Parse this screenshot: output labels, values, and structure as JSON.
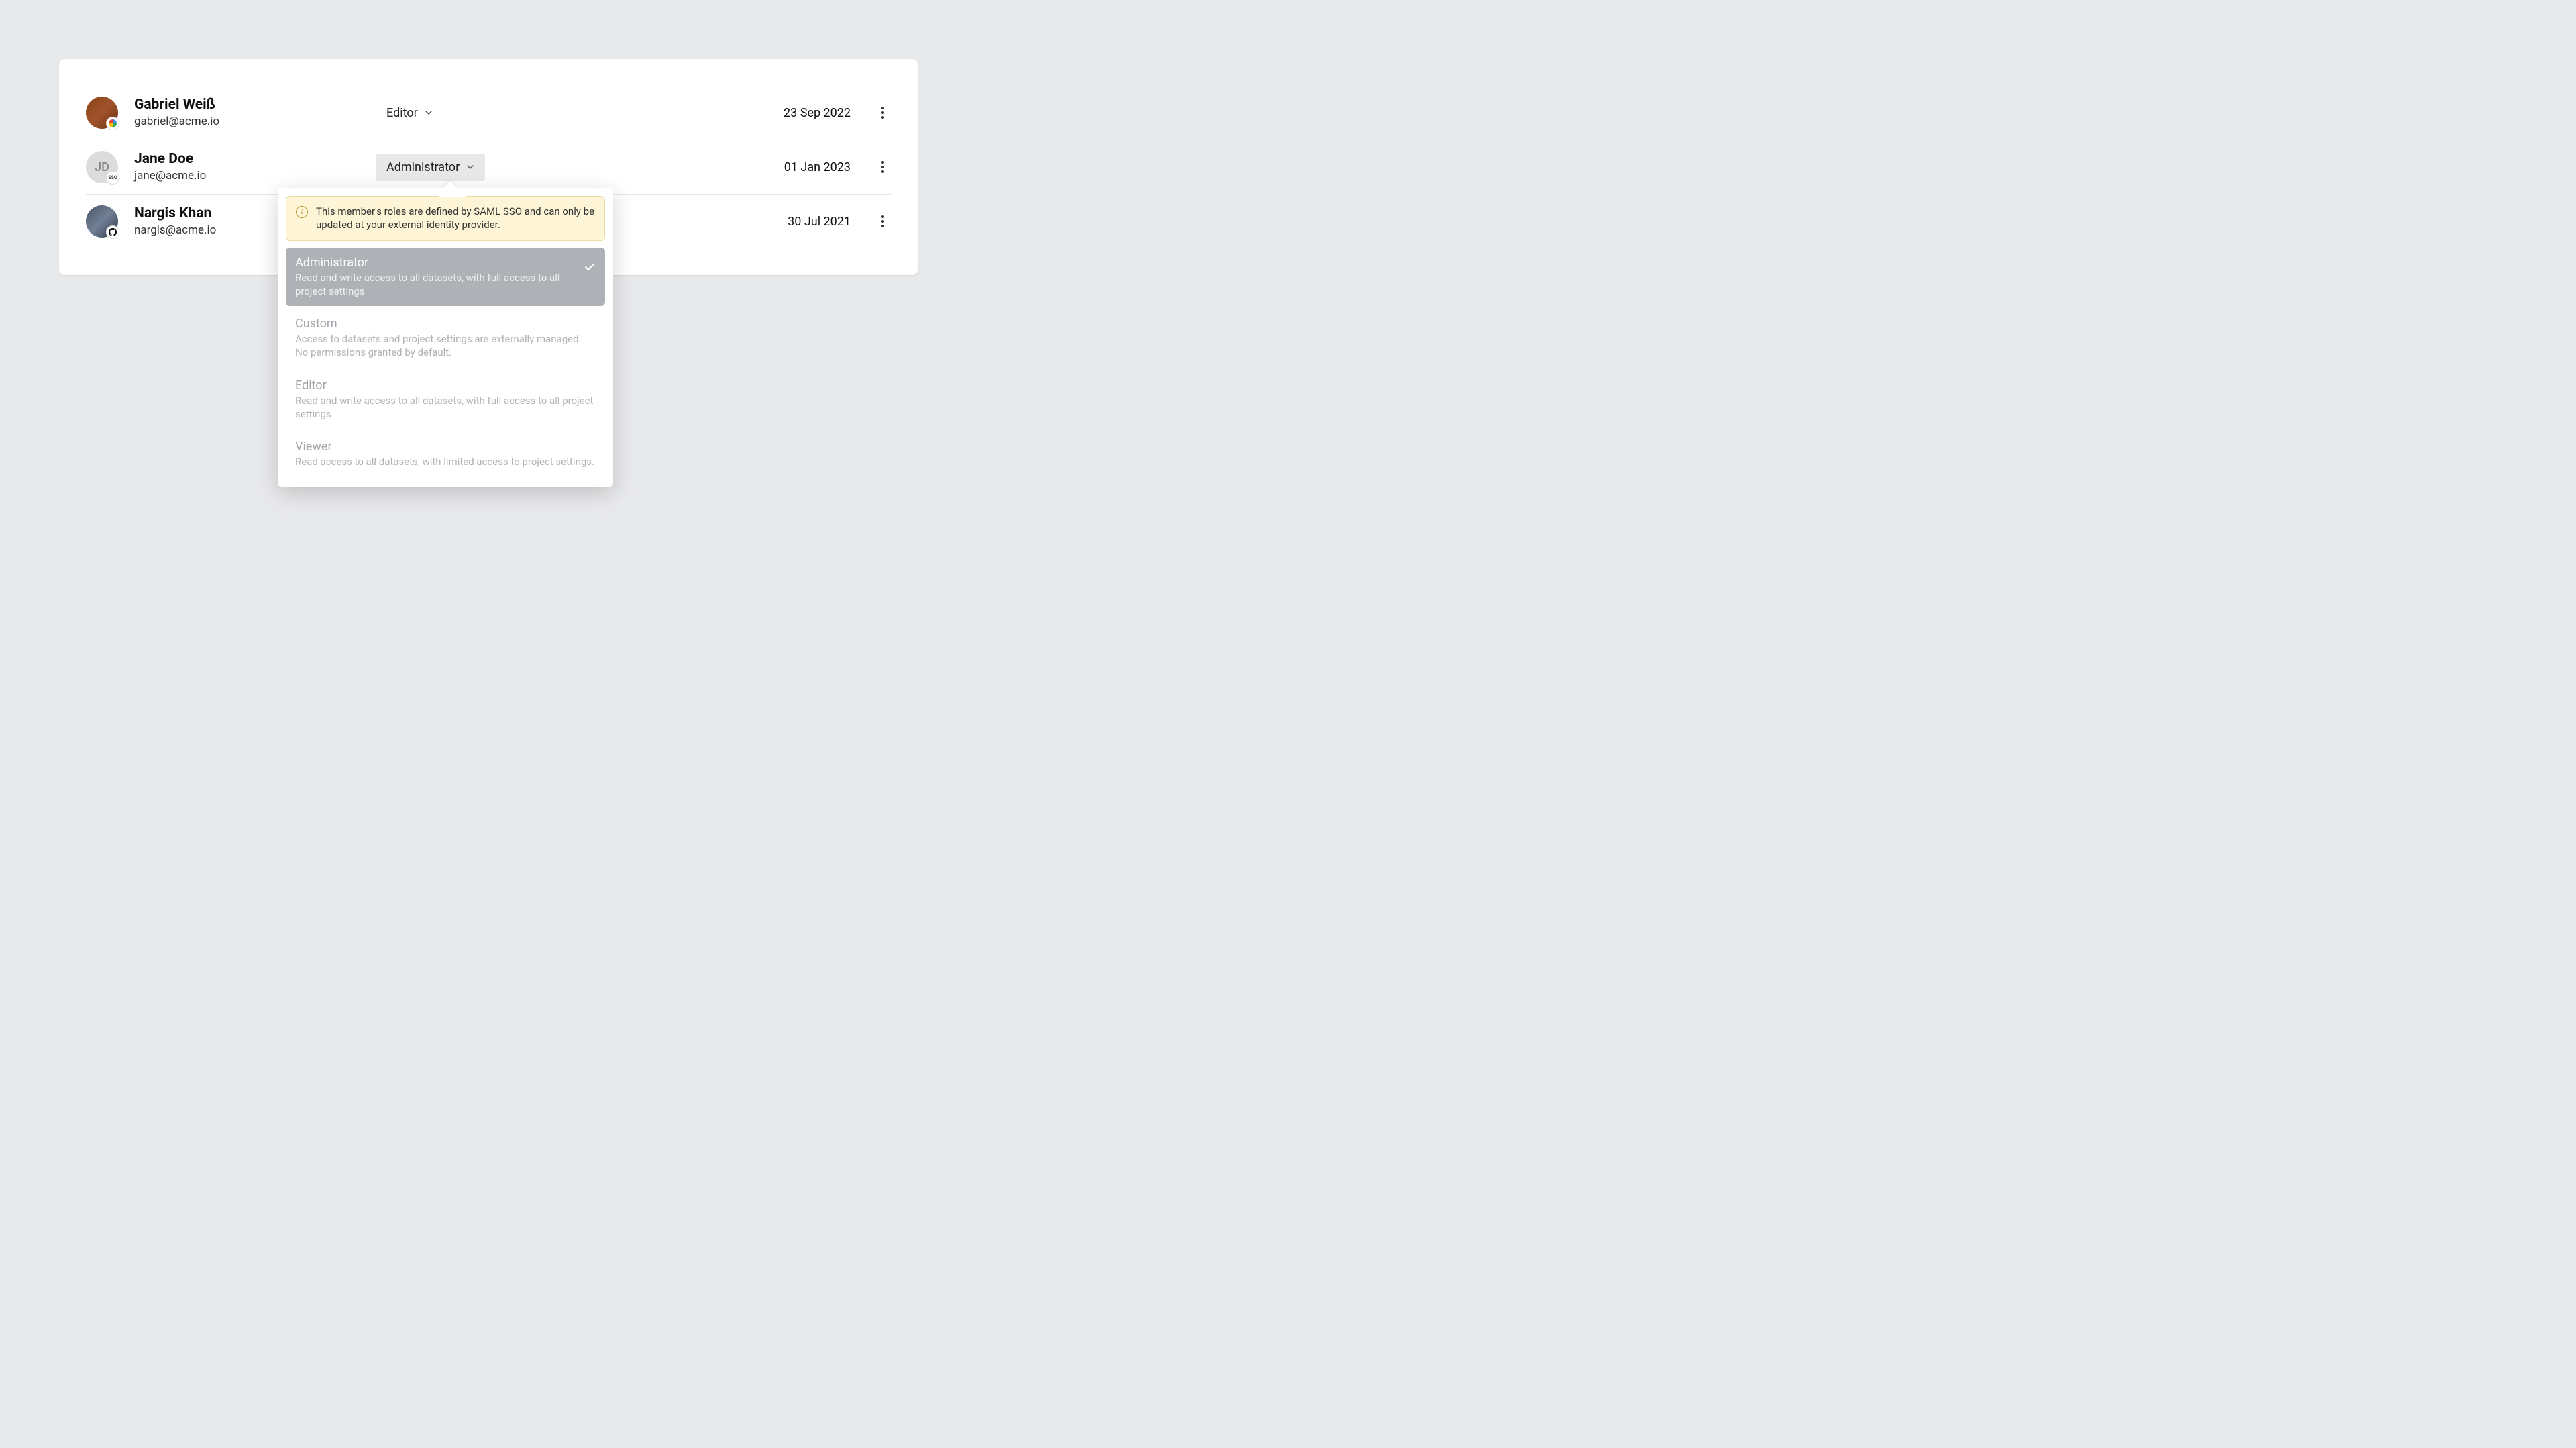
{
  "members": [
    {
      "name": "Gabriel Weiß",
      "email": "gabriel@acme.io",
      "role": "Editor",
      "date": "23 Sep 2022",
      "provider": "google",
      "initials": ""
    },
    {
      "name": "Jane Doe",
      "email": "jane@acme.io",
      "role": "Administrator",
      "date": "01 Jan 2023",
      "provider": "sso",
      "sso_label": "SSO",
      "initials": "JD"
    },
    {
      "name": "Nargis Khan",
      "email": "nargis@acme.io",
      "role": "",
      "date": "30 Jul 2021",
      "provider": "github",
      "initials": ""
    }
  ],
  "dropdown": {
    "notice": "This member's roles are defined by SAML SSO and can only be updated at your external identity provider.",
    "options": [
      {
        "title": "Administrator",
        "desc": "Read and write access to all datasets, with full access to all project settings",
        "selected": true
      },
      {
        "title": "Custom",
        "desc": "Access to datasets and project settings are externally managed. No permissions granted by default.",
        "selected": false
      },
      {
        "title": "Editor",
        "desc": "Read and write access to all datasets, with full access to all project settings",
        "selected": false
      },
      {
        "title": "Viewer",
        "desc": "Read access to all datasets, with limited access to project settings.",
        "selected": false
      }
    ]
  }
}
